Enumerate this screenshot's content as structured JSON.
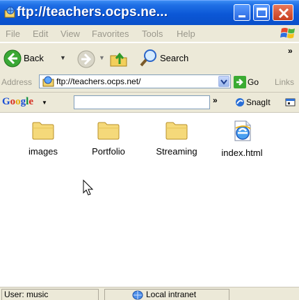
{
  "window": {
    "title": "ftp://teachers.ocps.ne..."
  },
  "menu": {
    "items": [
      "File",
      "Edit",
      "View",
      "Favorites",
      "Tools",
      "Help"
    ]
  },
  "toolbar": {
    "back_label": "Back",
    "search_label": "Search",
    "overflow": "»"
  },
  "address": {
    "label": "Address",
    "value": "ftp://teachers.ocps.net/",
    "go_label": "Go",
    "links_label": "Links"
  },
  "google_bar": {
    "logo": [
      "G",
      "o",
      "o",
      "g",
      "l",
      "e"
    ],
    "overflow": "»",
    "snagit_label": "SnagIt"
  },
  "files": [
    {
      "name": "images",
      "icon": "folder-icon"
    },
    {
      "name": "Portfolio",
      "icon": "folder-icon"
    },
    {
      "name": "Streaming",
      "icon": "folder-icon"
    },
    {
      "name": "index.html",
      "icon": "ie-document-icon"
    }
  ],
  "status": {
    "user": "User: music",
    "zone": "Local intranet"
  },
  "colors": {
    "titlebar": "#0b57d6",
    "chrome": "#ece9d8",
    "folder": "#f5d97a"
  }
}
